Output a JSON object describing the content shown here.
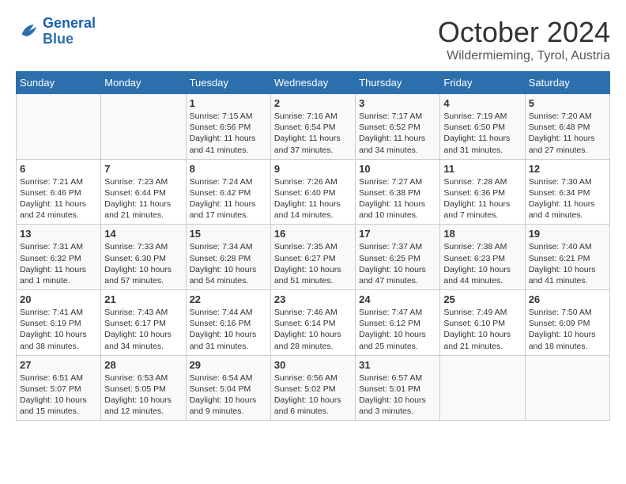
{
  "logo": {
    "line1": "General",
    "line2": "Blue"
  },
  "title": "October 2024",
  "subtitle": "Wildermieming, Tyrol, Austria",
  "header_days": [
    "Sunday",
    "Monday",
    "Tuesday",
    "Wednesday",
    "Thursday",
    "Friday",
    "Saturday"
  ],
  "weeks": [
    [
      {
        "day": "",
        "info": ""
      },
      {
        "day": "",
        "info": ""
      },
      {
        "day": "1",
        "info": "Sunrise: 7:15 AM\nSunset: 6:56 PM\nDaylight: 11 hours and 41 minutes."
      },
      {
        "day": "2",
        "info": "Sunrise: 7:16 AM\nSunset: 6:54 PM\nDaylight: 11 hours and 37 minutes."
      },
      {
        "day": "3",
        "info": "Sunrise: 7:17 AM\nSunset: 6:52 PM\nDaylight: 11 hours and 34 minutes."
      },
      {
        "day": "4",
        "info": "Sunrise: 7:19 AM\nSunset: 6:50 PM\nDaylight: 11 hours and 31 minutes."
      },
      {
        "day": "5",
        "info": "Sunrise: 7:20 AM\nSunset: 6:48 PM\nDaylight: 11 hours and 27 minutes."
      }
    ],
    [
      {
        "day": "6",
        "info": "Sunrise: 7:21 AM\nSunset: 6:46 PM\nDaylight: 11 hours and 24 minutes."
      },
      {
        "day": "7",
        "info": "Sunrise: 7:23 AM\nSunset: 6:44 PM\nDaylight: 11 hours and 21 minutes."
      },
      {
        "day": "8",
        "info": "Sunrise: 7:24 AM\nSunset: 6:42 PM\nDaylight: 11 hours and 17 minutes."
      },
      {
        "day": "9",
        "info": "Sunrise: 7:26 AM\nSunset: 6:40 PM\nDaylight: 11 hours and 14 minutes."
      },
      {
        "day": "10",
        "info": "Sunrise: 7:27 AM\nSunset: 6:38 PM\nDaylight: 11 hours and 10 minutes."
      },
      {
        "day": "11",
        "info": "Sunrise: 7:28 AM\nSunset: 6:36 PM\nDaylight: 11 hours and 7 minutes."
      },
      {
        "day": "12",
        "info": "Sunrise: 7:30 AM\nSunset: 6:34 PM\nDaylight: 11 hours and 4 minutes."
      }
    ],
    [
      {
        "day": "13",
        "info": "Sunrise: 7:31 AM\nSunset: 6:32 PM\nDaylight: 11 hours and 1 minute."
      },
      {
        "day": "14",
        "info": "Sunrise: 7:33 AM\nSunset: 6:30 PM\nDaylight: 10 hours and 57 minutes."
      },
      {
        "day": "15",
        "info": "Sunrise: 7:34 AM\nSunset: 6:28 PM\nDaylight: 10 hours and 54 minutes."
      },
      {
        "day": "16",
        "info": "Sunrise: 7:35 AM\nSunset: 6:27 PM\nDaylight: 10 hours and 51 minutes."
      },
      {
        "day": "17",
        "info": "Sunrise: 7:37 AM\nSunset: 6:25 PM\nDaylight: 10 hours and 47 minutes."
      },
      {
        "day": "18",
        "info": "Sunrise: 7:38 AM\nSunset: 6:23 PM\nDaylight: 10 hours and 44 minutes."
      },
      {
        "day": "19",
        "info": "Sunrise: 7:40 AM\nSunset: 6:21 PM\nDaylight: 10 hours and 41 minutes."
      }
    ],
    [
      {
        "day": "20",
        "info": "Sunrise: 7:41 AM\nSunset: 6:19 PM\nDaylight: 10 hours and 38 minutes."
      },
      {
        "day": "21",
        "info": "Sunrise: 7:43 AM\nSunset: 6:17 PM\nDaylight: 10 hours and 34 minutes."
      },
      {
        "day": "22",
        "info": "Sunrise: 7:44 AM\nSunset: 6:16 PM\nDaylight: 10 hours and 31 minutes."
      },
      {
        "day": "23",
        "info": "Sunrise: 7:46 AM\nSunset: 6:14 PM\nDaylight: 10 hours and 28 minutes."
      },
      {
        "day": "24",
        "info": "Sunrise: 7:47 AM\nSunset: 6:12 PM\nDaylight: 10 hours and 25 minutes."
      },
      {
        "day": "25",
        "info": "Sunrise: 7:49 AM\nSunset: 6:10 PM\nDaylight: 10 hours and 21 minutes."
      },
      {
        "day": "26",
        "info": "Sunrise: 7:50 AM\nSunset: 6:09 PM\nDaylight: 10 hours and 18 minutes."
      }
    ],
    [
      {
        "day": "27",
        "info": "Sunrise: 6:51 AM\nSunset: 5:07 PM\nDaylight: 10 hours and 15 minutes."
      },
      {
        "day": "28",
        "info": "Sunrise: 6:53 AM\nSunset: 5:05 PM\nDaylight: 10 hours and 12 minutes."
      },
      {
        "day": "29",
        "info": "Sunrise: 6:54 AM\nSunset: 5:04 PM\nDaylight: 10 hours and 9 minutes."
      },
      {
        "day": "30",
        "info": "Sunrise: 6:56 AM\nSunset: 5:02 PM\nDaylight: 10 hours and 6 minutes."
      },
      {
        "day": "31",
        "info": "Sunrise: 6:57 AM\nSunset: 5:01 PM\nDaylight: 10 hours and 3 minutes."
      },
      {
        "day": "",
        "info": ""
      },
      {
        "day": "",
        "info": ""
      }
    ]
  ]
}
